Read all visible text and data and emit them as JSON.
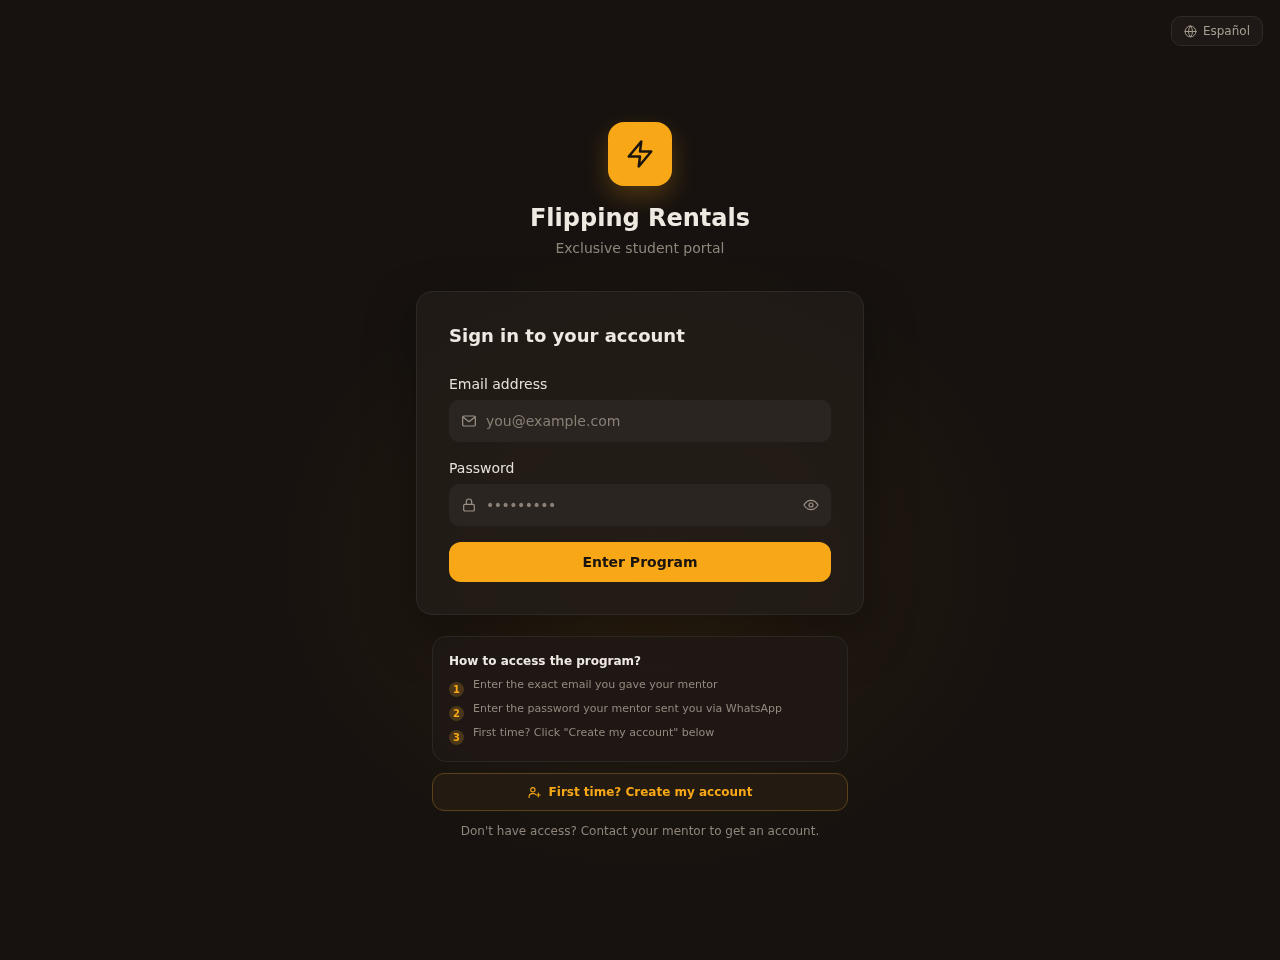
{
  "language_button": {
    "label": "Español"
  },
  "brand": {
    "name": "Flipping Rentals",
    "tagline": "Exclusive student portal"
  },
  "sign_in": {
    "title": "Sign in to your account",
    "fields": [
      {
        "kind": "email",
        "label": "Email address",
        "placeholder": "you@example.com"
      },
      {
        "kind": "password",
        "label": "Password",
        "placeholder": "•••••••••"
      }
    ],
    "submit_button": "Enter Program"
  },
  "help": {
    "title": "How to access the program?",
    "steps": [
      {
        "number": "1",
        "text": "Enter the exact email you gave your mentor"
      },
      {
        "number": "2",
        "text": "Enter the password your mentor sent you via WhatsApp"
      },
      {
        "number": "3",
        "text": "First time? Click \"Create my account\" below"
      }
    ]
  },
  "create_account_button": "First time? Create my account",
  "footer_note": "Don't have access? Contact your mentor to get an account."
}
